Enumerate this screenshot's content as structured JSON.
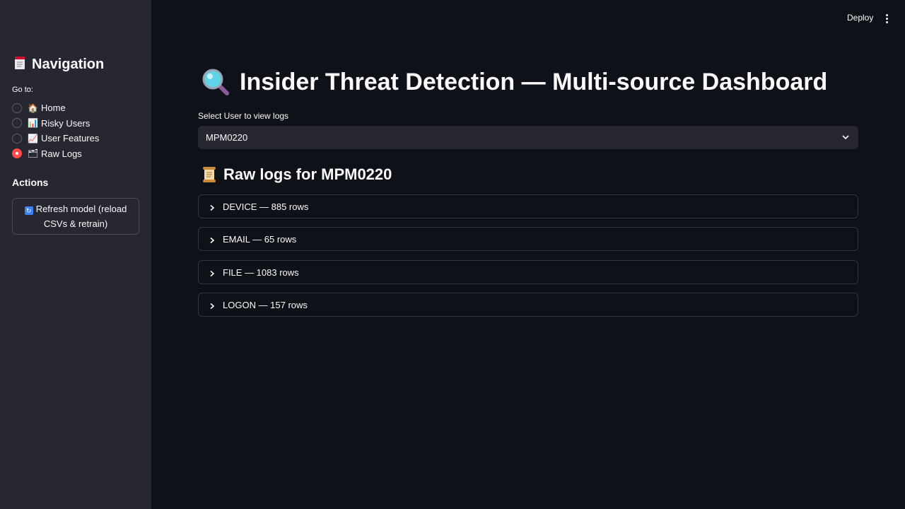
{
  "topbar": {
    "deploy_label": "Deploy"
  },
  "sidebar": {
    "title": "Navigation",
    "goto_label": "Go to:",
    "nav_items": [
      {
        "label": "Home",
        "emoji": "🏠",
        "selected": false
      },
      {
        "label": "Risky Users",
        "emoji": "📊",
        "selected": false
      },
      {
        "label": "User Features",
        "emoji": "📈",
        "selected": false
      },
      {
        "label": "Raw Logs",
        "emoji": "🗂",
        "selected": true
      }
    ],
    "actions_label": "Actions",
    "refresh_label_1": "Refresh model (reload",
    "refresh_label_2": "CSVs & retrain)"
  },
  "main": {
    "title": "Insider Threat Detection — Multi-source Dashboard",
    "select_label": "Select User to view logs",
    "selected_user": "MPM0220",
    "subtitle": "Raw logs for MPM0220",
    "expanders": [
      {
        "label": "DEVICE — 885 rows"
      },
      {
        "label": "EMAIL — 65 rows"
      },
      {
        "label": "FILE — 1083 rows"
      },
      {
        "label": "LOGON — 157 rows"
      }
    ]
  },
  "colors": {
    "accent": "#ff4b4b",
    "background": "#0e1117",
    "sidebar": "#262730"
  },
  "icons": [
    "page-icon",
    "magnifier-icon",
    "scroll-icon",
    "refresh-icon",
    "chevron-down-icon",
    "chevron-right-icon",
    "kebab-menu-icon"
  ]
}
